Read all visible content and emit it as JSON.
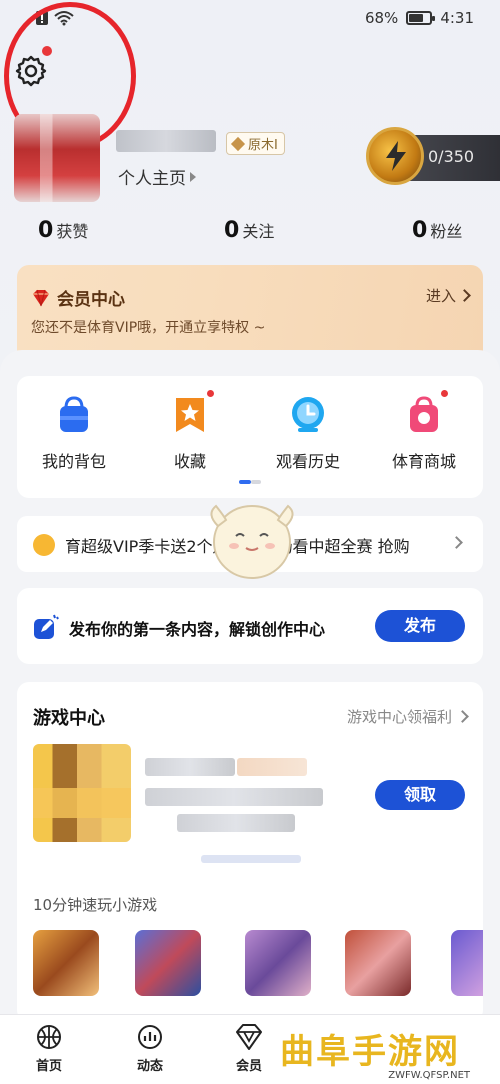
{
  "status_bar": {
    "battery_text": "68%",
    "time": "4:31",
    "battery_level": 0.68
  },
  "profile": {
    "rank_label": "原木I",
    "homepage_link": "个人主页",
    "energy_text": "0/350"
  },
  "stats": [
    {
      "value": "0",
      "label": "获赞"
    },
    {
      "value": "0",
      "label": "关注"
    },
    {
      "value": "0",
      "label": "粉丝"
    }
  ],
  "vip": {
    "title": "会员中心",
    "subtitle": "您还不是体育VIP哦，开通立享特权 ~",
    "enter_label": "进入"
  },
  "shortcuts": [
    {
      "label": "我的背包",
      "icon": "bag-icon",
      "color": "#2b6cf0",
      "badge": false
    },
    {
      "label": "收藏",
      "icon": "star-bookmark-icon",
      "color": "#f28a1e",
      "badge": true
    },
    {
      "label": "观看历史",
      "icon": "clock-icon",
      "color": "#1fa7f0",
      "badge": false
    },
    {
      "label": "体育商城",
      "icon": "shop-bag-icon",
      "color": "#f04a78",
      "badge": true
    }
  ],
  "promo_banner": {
    "text": "育超级VIP季卡送2个月月卡，畅看中超全赛 抢购"
  },
  "publish": {
    "text": "发布你的第一条内容，解锁创作中心",
    "button": "发布"
  },
  "games": {
    "title": "游戏中心",
    "more_label": "游戏中心领福利",
    "claim_button": "领取",
    "mini_title": "10分钟速玩小游戏"
  },
  "tabbar": [
    {
      "label": "首页",
      "icon": "basketball-icon"
    },
    {
      "label": "动态",
      "icon": "activity-chart-icon"
    },
    {
      "label": "会员",
      "icon": "diamond-icon"
    }
  ],
  "watermark": {
    "title": "曲阜手游网",
    "url": "ZWFW.QFSP.NET"
  },
  "colors": {
    "accent": "#1d52d6",
    "badge_red": "#e8373a",
    "annotation_red": "#e6252b",
    "watermark": "#e8b61f"
  }
}
